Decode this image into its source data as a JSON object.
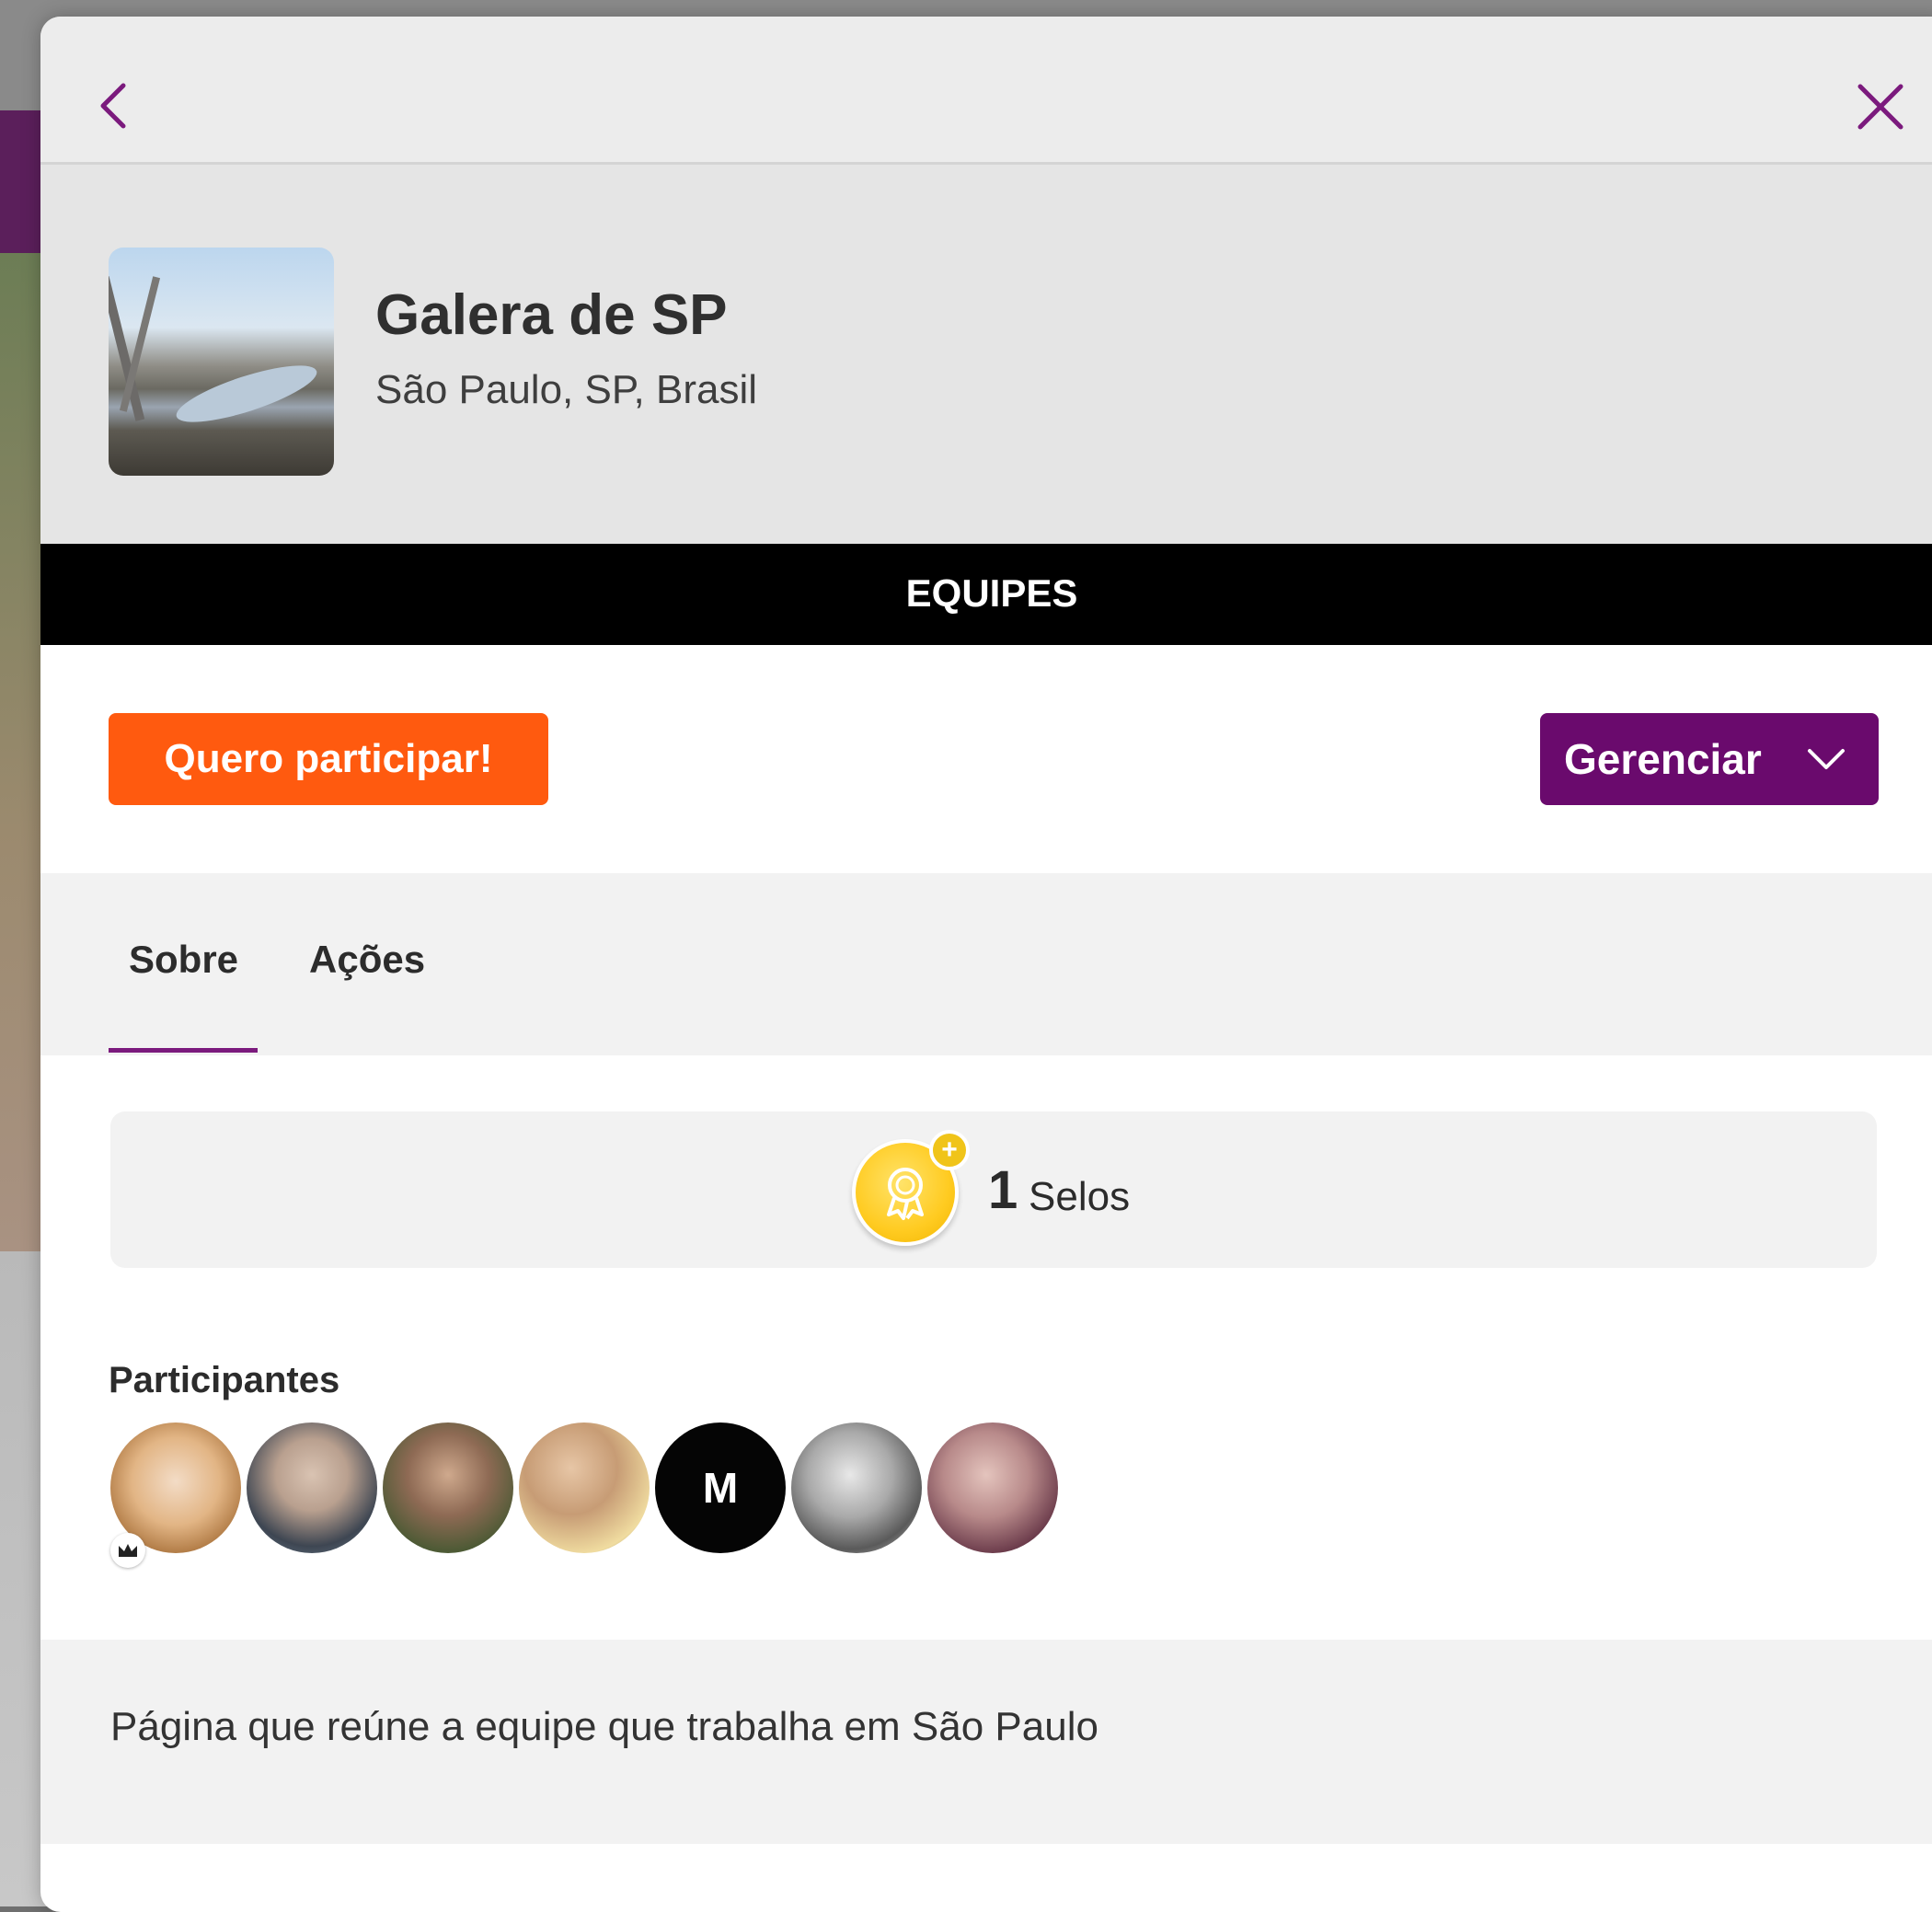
{
  "team": {
    "name": "Galera de SP",
    "location": "São Paulo, SP, Brasil"
  },
  "section_bar": {
    "title": "EQUIPES"
  },
  "actions": {
    "join_label": "Quero participar!",
    "manage_label": "Gerenciar"
  },
  "tabs": [
    {
      "label": "Sobre",
      "active": true
    },
    {
      "label": "Ações",
      "active": false
    }
  ],
  "badges": {
    "count": "1",
    "label": "Selos"
  },
  "participants": {
    "title": "Participantes",
    "avatars": [
      {
        "initial": ""
      },
      {
        "initial": ""
      },
      {
        "initial": ""
      },
      {
        "initial": ""
      },
      {
        "initial": "M"
      },
      {
        "initial": ""
      },
      {
        "initial": ""
      }
    ]
  },
  "description": "Página que reúne a equipe que trabalha em São Paulo",
  "colors": {
    "join_button": "#ff5a0f",
    "manage_button": "#6a0a6d",
    "accent": "#7b1a7d",
    "section_bar": "#000000"
  },
  "icons": {
    "back": "chevron-left-icon",
    "close": "close-icon",
    "dropdown": "chevron-down-icon",
    "medal": "medal-icon",
    "plus": "plus-icon",
    "crown": "crown-icon"
  }
}
